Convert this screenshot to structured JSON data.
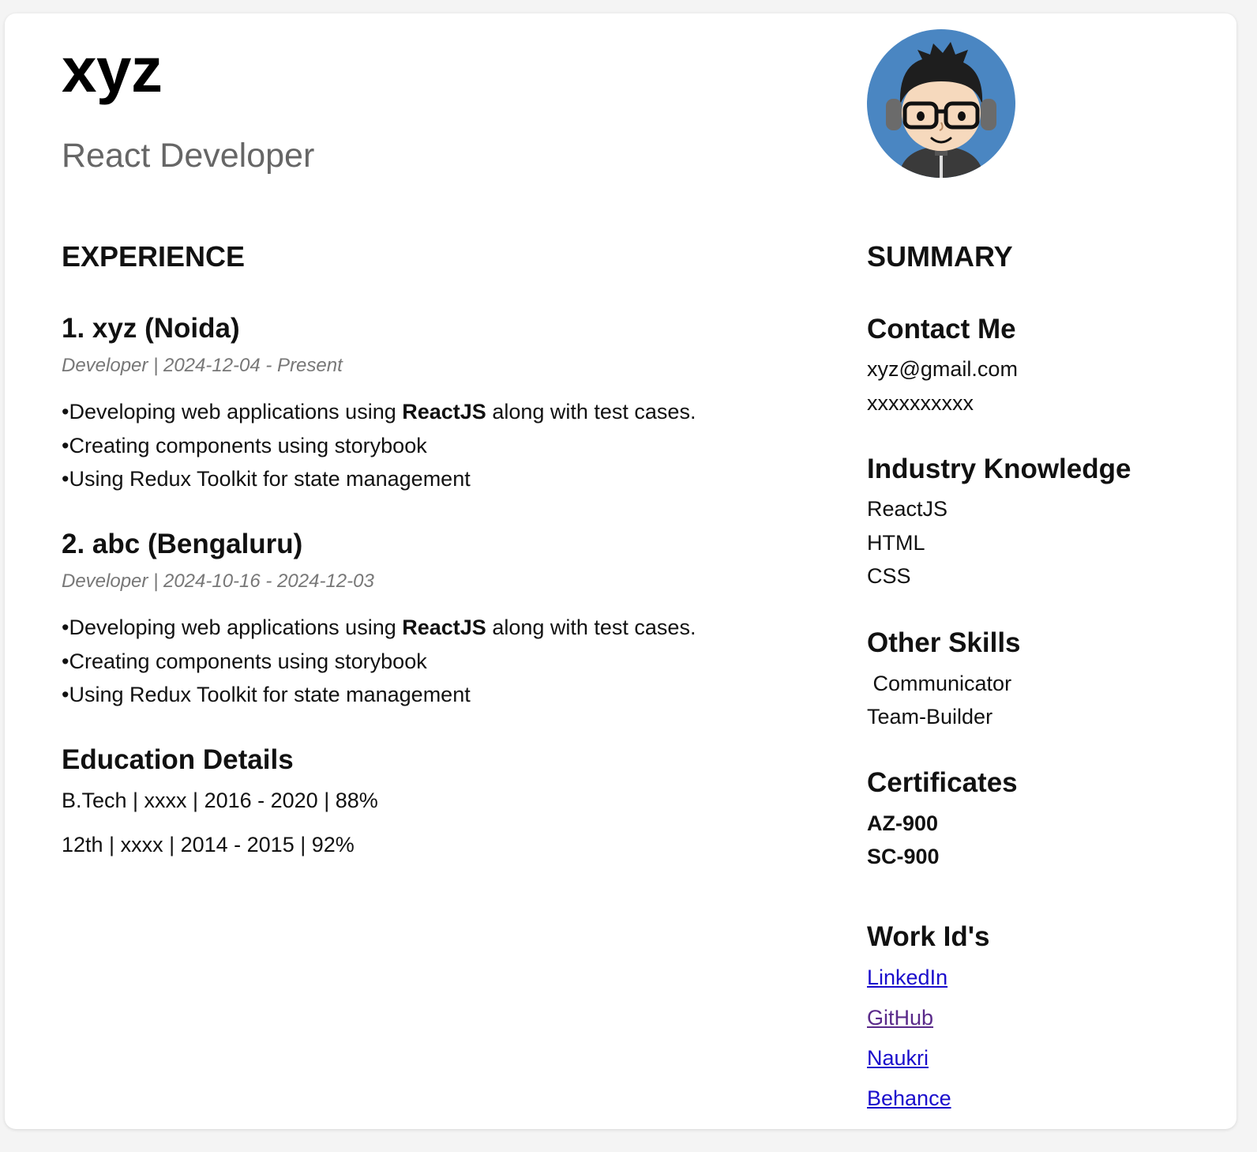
{
  "header": {
    "name": "xyz",
    "role": "React Developer"
  },
  "experience": {
    "title": "EXPERIENCE",
    "jobs": [
      {
        "heading": "1. xyz (Noida)",
        "meta": "Developer | 2024-12-04 - Present",
        "bullets": [
          {
            "before": "Developing web applications using ",
            "bold": "ReactJS",
            "after": " along with test cases."
          },
          {
            "before": "Creating components using storybook",
            "bold": "",
            "after": ""
          },
          {
            "before": "Using Redux Toolkit for state management",
            "bold": "",
            "after": ""
          }
        ]
      },
      {
        "heading": "2. abc (Bengaluru)",
        "meta": "Developer | 2024-10-16 - 2024-12-03",
        "bullets": [
          {
            "before": "Developing web applications using ",
            "bold": "ReactJS",
            "after": " along with test cases."
          },
          {
            "before": "Creating components using storybook",
            "bold": "",
            "after": ""
          },
          {
            "before": "Using Redux Toolkit for state management",
            "bold": "",
            "after": ""
          }
        ]
      }
    ]
  },
  "education": {
    "title": "Education Details",
    "lines": [
      "B.Tech | xxxx | 2016 - 2020 | 88%",
      "12th | xxxx | 2014 - 2015 | 92%"
    ]
  },
  "summary": {
    "title": "SUMMARY",
    "contact": {
      "title": "Contact Me",
      "email": "xyz@gmail.com",
      "phone": "xxxxxxxxxx"
    },
    "industry": {
      "title": "Industry Knowledge",
      "items": [
        "ReactJS",
        "HTML",
        "CSS"
      ]
    },
    "other_skills": {
      "title": "Other Skills",
      "items": [
        " Communicator",
        "Team-Builder"
      ]
    },
    "certificates": {
      "title": "Certificates",
      "items": [
        "AZ-900",
        "SC-900"
      ]
    },
    "work_ids": {
      "title": "Work Id's",
      "links": [
        "LinkedIn",
        "GitHub",
        "Naukri",
        "Behance"
      ]
    }
  },
  "avatar": {
    "icon": "avatar-icon",
    "bg_color": "#4a86c2"
  },
  "colors": {
    "link": "#1a0dcc",
    "visited_link": "#5a2a8a",
    "muted": "#777777"
  }
}
